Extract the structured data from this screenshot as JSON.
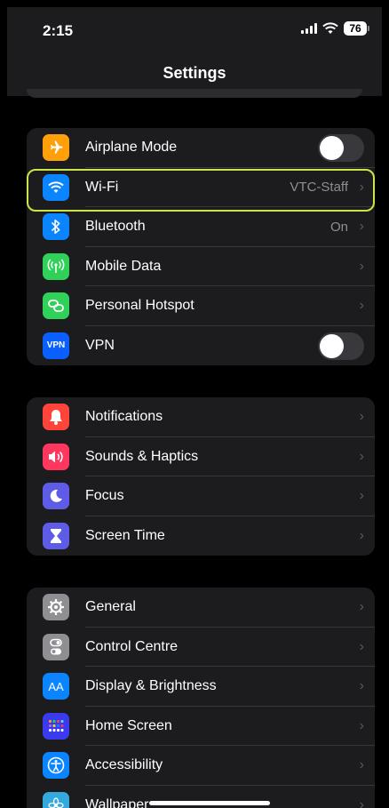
{
  "status": {
    "time": "2:15",
    "battery": "76"
  },
  "header": {
    "title": "Settings"
  },
  "groups": [
    {
      "items": [
        {
          "label": "Airplane Mode",
          "icon": "airplane-icon",
          "color": "#ff9f0a",
          "control": "toggle",
          "toggle_on": false
        },
        {
          "label": "Wi-Fi",
          "value": "VTC-Staff",
          "icon": "wifi-icon",
          "color": "#0a84ff",
          "control": "chevron",
          "highlighted": true
        },
        {
          "label": "Bluetooth",
          "value": "On",
          "icon": "bluetooth-icon",
          "color": "#0a84ff",
          "control": "chevron"
        },
        {
          "label": "Mobile Data",
          "icon": "antenna-icon",
          "color": "#30d158",
          "control": "chevron"
        },
        {
          "label": "Personal Hotspot",
          "icon": "hotspot-icon",
          "color": "#30d158",
          "control": "chevron"
        },
        {
          "label": "VPN",
          "icon": "vpn-icon",
          "icon_text": "VPN",
          "color": "#0a5fff",
          "control": "toggle",
          "toggle_on": false
        }
      ]
    },
    {
      "items": [
        {
          "label": "Notifications",
          "icon": "bell-icon",
          "color": "#ff453a",
          "control": "chevron"
        },
        {
          "label": "Sounds & Haptics",
          "icon": "speaker-icon",
          "color": "#ff375f",
          "control": "chevron"
        },
        {
          "label": "Focus",
          "icon": "moon-icon",
          "color": "#5e5ce6",
          "control": "chevron"
        },
        {
          "label": "Screen Time",
          "icon": "hourglass-icon",
          "color": "#5e5ce6",
          "control": "chevron"
        }
      ]
    },
    {
      "items": [
        {
          "label": "General",
          "icon": "gear-icon",
          "color": "#8e8e93",
          "control": "chevron"
        },
        {
          "label": "Control Centre",
          "icon": "switches-icon",
          "color": "#8e8e93",
          "control": "chevron"
        },
        {
          "label": "Display & Brightness",
          "icon": "display-icon",
          "icon_text": "AA",
          "color": "#0a84ff",
          "control": "chevron"
        },
        {
          "label": "Home Screen",
          "icon": "home-grid-icon",
          "color": "#3a3aef",
          "control": "chevron"
        },
        {
          "label": "Accessibility",
          "icon": "accessibility-icon",
          "color": "#0a84ff",
          "control": "chevron"
        },
        {
          "label": "Wallpaper",
          "icon": "flower-icon",
          "color": "#34aadc",
          "control": "chevron"
        }
      ]
    }
  ]
}
